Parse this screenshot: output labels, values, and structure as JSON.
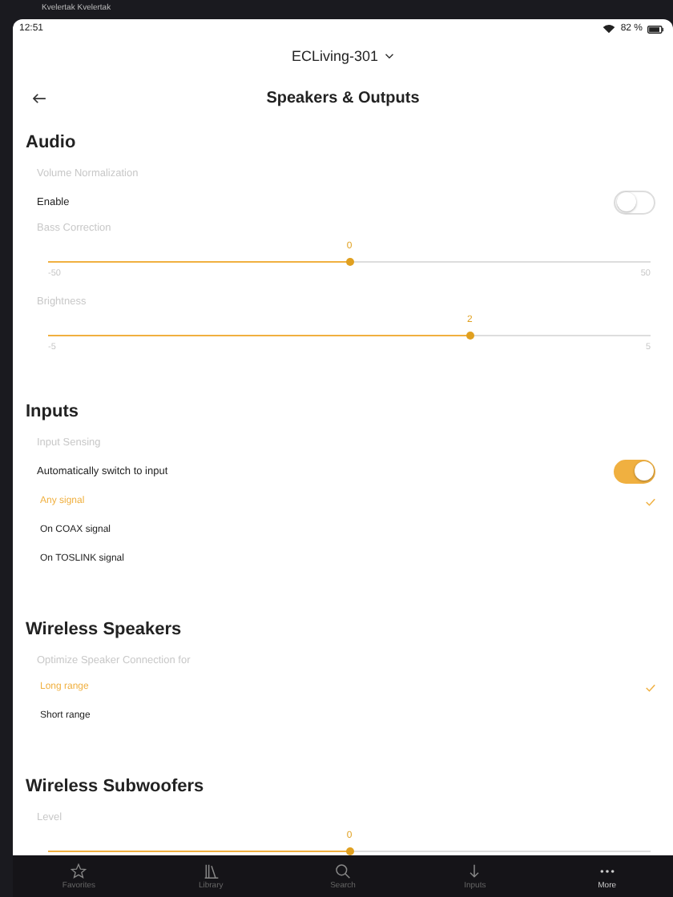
{
  "background": {
    "track_text": "Kvelertak Kvelertak"
  },
  "status_bar": {
    "time": "12:51",
    "battery": "82 %"
  },
  "device": {
    "name": "ECLiving-301"
  },
  "header": {
    "title": "Speakers & Outputs"
  },
  "sections": [
    {
      "title": "Audio",
      "items": [
        {
          "kind": "caption",
          "text": "Volume Normalization"
        },
        {
          "kind": "toggle",
          "label": "Enable",
          "on": false
        },
        {
          "kind": "caption",
          "text": "Bass Correction"
        },
        {
          "kind": "slider",
          "value": "0",
          "min": "-50",
          "max": "50",
          "level": 0.5
        },
        {
          "kind": "caption",
          "text": "Brightness"
        },
        {
          "kind": "slider",
          "value": "2",
          "min": "-5",
          "max": "5",
          "level": 0.7
        }
      ]
    },
    {
      "title": "Inputs",
      "items": [
        {
          "kind": "caption",
          "text": "Input Sensing"
        },
        {
          "kind": "toggle",
          "label": "Automatically switch to input",
          "on": true
        },
        {
          "kind": "option",
          "label": "Any signal",
          "selected": true
        },
        {
          "kind": "option",
          "label": "On COAX signal",
          "selected": false
        },
        {
          "kind": "option",
          "label": "On TOSLINK signal",
          "selected": false
        }
      ]
    },
    {
      "title": "Wireless Speakers",
      "items": [
        {
          "kind": "caption",
          "text": "Optimize Speaker Connection for"
        },
        {
          "kind": "option",
          "label": "Long range",
          "selected": true
        },
        {
          "kind": "option",
          "label": "Short range",
          "selected": false
        }
      ]
    },
    {
      "title": "Wireless Subwoofers",
      "items": [
        {
          "kind": "caption",
          "text": "Level"
        },
        {
          "kind": "slider",
          "value": "0",
          "level": 0.5
        }
      ]
    }
  ],
  "tab_bar": [
    {
      "kind": "star",
      "label": "Favorites",
      "selected": false
    },
    {
      "kind": "books",
      "label": "Library",
      "selected": false
    },
    {
      "kind": "search",
      "label": "Search",
      "selected": false
    },
    {
      "kind": "arrow",
      "label": "Inputs",
      "selected": false
    },
    {
      "kind": "more",
      "label": "More",
      "selected": true
    }
  ]
}
